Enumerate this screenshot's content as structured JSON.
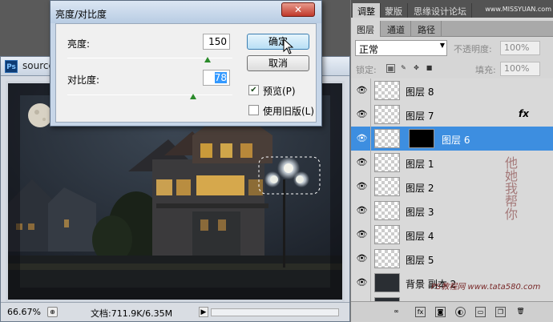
{
  "document": {
    "title": "source",
    "zoom": "66.67%",
    "doc_info": "文档:711.9K/6.35M"
  },
  "dialog": {
    "title": "亮度/对比度",
    "close_label": "✕",
    "brightness_label": "亮度:",
    "brightness_value": "150",
    "contrast_label": "对比度:",
    "contrast_value": "78",
    "ok_label": "确定",
    "cancel_label": "取消",
    "preview_label": "预览(P)",
    "preview_checked": true,
    "legacy_label": "使用旧版(L)",
    "legacy_checked": false,
    "brightness_slider_pos": 0.85,
    "contrast_slider_pos": 0.76
  },
  "panel": {
    "top_tabs": [
      "调整",
      "蒙版",
      "思缘设计论坛"
    ],
    "watermark": "www.MISSYUAN.com",
    "layer_tabs": [
      "图层",
      "通道",
      "路径"
    ],
    "blend_mode": "正常",
    "opacity_label": "不透明度:",
    "opacity_value": "100%",
    "lock_label": "锁定:",
    "fill_label": "填充:",
    "fill_value": "100%",
    "layers": [
      {
        "name": "图层 8",
        "selected": false,
        "fx": false
      },
      {
        "name": "图层 7",
        "selected": false,
        "fx": true
      },
      {
        "name": "图层 6",
        "selected": true,
        "fx": false
      },
      {
        "name": "图层 1",
        "selected": false,
        "fx": false
      },
      {
        "name": "图层 2",
        "selected": false,
        "fx": false
      },
      {
        "name": "图层 3",
        "selected": false,
        "fx": false
      },
      {
        "name": "图层 4",
        "selected": false,
        "fx": false
      },
      {
        "name": "图层 5",
        "selected": false,
        "fx": false
      },
      {
        "name": "背景 副本 2",
        "selected": false,
        "fx": false
      },
      {
        "name": "背景",
        "selected": false,
        "fx": false
      }
    ],
    "fx_label": "fx",
    "site_watermark": "PS教程网 www.tata580.com",
    "seal_text": "他她我帮你"
  }
}
